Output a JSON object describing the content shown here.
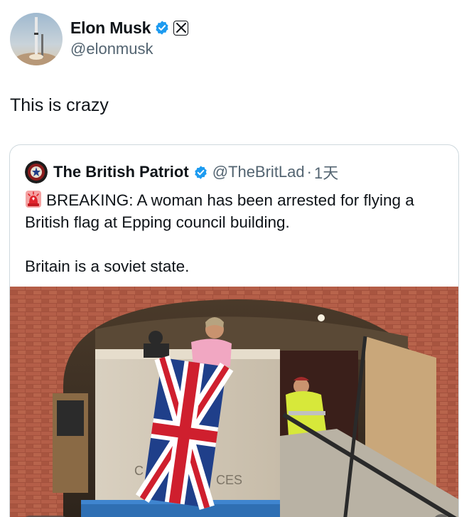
{
  "author": {
    "display_name": "Elon Musk",
    "handle": "@elonmusk",
    "verified_icon": "verified-badge-icon",
    "affiliate_icon": "x-logo-icon"
  },
  "tweet": {
    "text": "This is crazy"
  },
  "quoted_tweet": {
    "display_name": "The British Patriot",
    "handle": "@TheBritLad",
    "separator": "·",
    "time": "1天",
    "body_line1": "BREAKING: A woman has been arrested for flying a British flag at Epping council building.",
    "body_line2": "Britain is a soviet state.",
    "alert_icon": "police-siren-icon"
  },
  "media": {
    "sign_left": "C",
    "sign_right": "CES"
  },
  "colors": {
    "verified_blue": "#1d9bf0",
    "secondary_text": "#536471",
    "border": "#cfd9de"
  }
}
